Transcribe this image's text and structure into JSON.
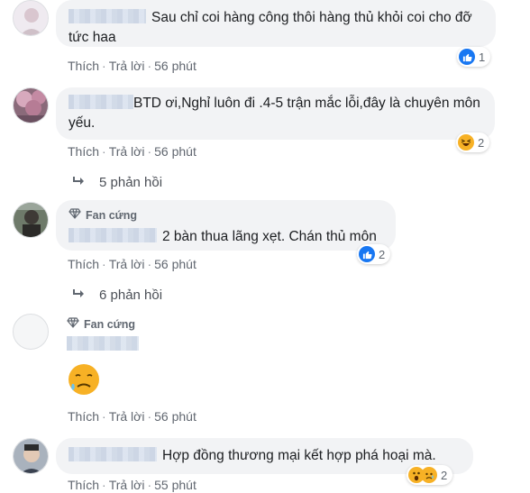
{
  "actions": {
    "like": "Thích",
    "reply": "Trả lời",
    "separator": "·"
  },
  "comments": [
    {
      "text": "Sau chỉ coi hàng công thôi hàng thủ khỏi coi cho đỡ tức haa",
      "time": "56 phút",
      "reaction_count": "1",
      "reaction_icon": "like-icon"
    },
    {
      "text": "BTD ơi,Nghỉ luôn đi .4-5 trận mắc lỗi,đây là chuyên môn yếu.",
      "time": "56 phút",
      "reaction_count": "2",
      "reaction_icon": "haha-icon",
      "replies": "5 phản hồi"
    },
    {
      "badge": "Fan cứng",
      "text": "2 bàn thua lãng xẹt. Chán thủ môn",
      "time": "56 phút",
      "reaction_count": "2",
      "reaction_icon": "like-icon",
      "replies": "6 phản hồi"
    },
    {
      "badge": "Fan cứng",
      "sticker": "sad-sweat-emoji",
      "time": "56 phút"
    },
    {
      "text": "Hợp đồng thương mại kết hợp phá hoại mà.",
      "time": "55 phút",
      "reaction_count": "2",
      "reaction_icon": "wow-sad-icons"
    }
  ],
  "colors": {
    "like_blue": "#1877f2",
    "bubble_bg": "#f2f3f5",
    "emoji_yellow": "#f7b125"
  }
}
